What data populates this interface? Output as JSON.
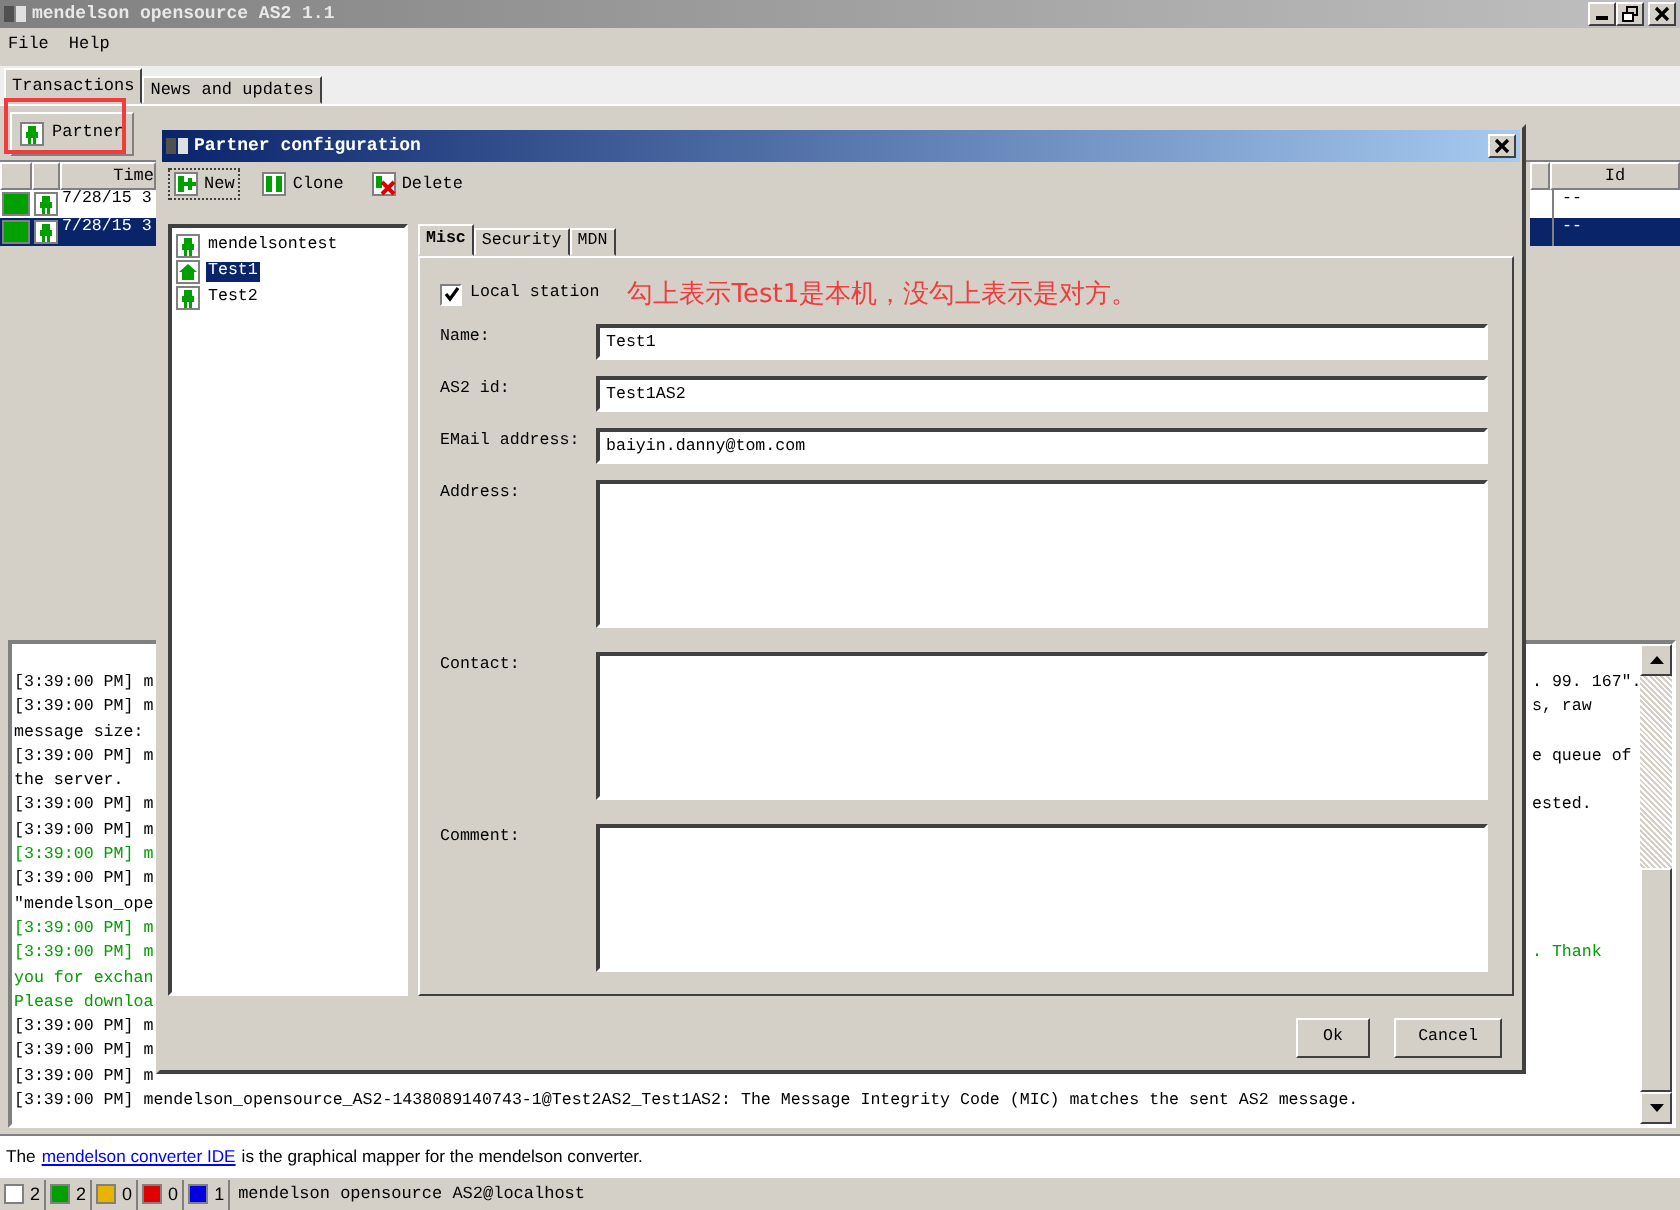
{
  "window": {
    "title": "mendelson opensource AS2 1.1"
  },
  "menu": [
    "File",
    "Help"
  ],
  "tabs": [
    {
      "label": "Transactions",
      "selected": true
    },
    {
      "label": "News and updates",
      "selected": false
    }
  ],
  "toolbar": {
    "partner_button": "Partner",
    "highlighted": true
  },
  "table": {
    "columns": [
      "Time",
      "Id"
    ],
    "rows": [
      {
        "color": "#00a000",
        "time": "7/28/15 3",
        "id": "--",
        "selected": false
      },
      {
        "color": "#00a000",
        "time": "7/28/15 3",
        "id": "--",
        "selected": true
      }
    ]
  },
  "log": [
    {
      "left": "[3:39:00 PM] m",
      "right": ". 99. 167\".",
      "kind": "normal"
    },
    {
      "left": "[3:39:00 PM] m",
      "right": "s, raw",
      "kind": "normal"
    },
    {
      "left": "message size:",
      "kind": "normal"
    },
    {
      "left": "[3:39:00 PM] m",
      "right": "e queue of",
      "kind": "normal"
    },
    {
      "left": "the server.",
      "kind": "normal"
    },
    {
      "left": "[3:39:00 PM] m",
      "right": "ested.",
      "kind": "normal"
    },
    {
      "left": "[3:39:00 PM] m",
      "kind": "normal"
    },
    {
      "left": "[3:39:00 PM] m",
      "kind": "success"
    },
    {
      "left": "[3:39:00 PM] m",
      "kind": "normal"
    },
    {
      "left": "\"mendelson_ope",
      "kind": "normal"
    },
    {
      "left": "[3:39:00 PM] m",
      "kind": "success"
    },
    {
      "left": "[3:39:00 PM] m",
      "right": ". Thank",
      "kind": "success"
    },
    {
      "left": "you for exchan",
      "kind": "success"
    },
    {
      "left": "Please downloa",
      "kind": "success"
    },
    {
      "left": "[3:39:00 PM] m",
      "kind": "normal"
    },
    {
      "left": "[3:39:00 PM] m",
      "kind": "normal"
    },
    {
      "left": "[3:39:00 PM] m",
      "kind": "normal"
    },
    {
      "left": "[3:39:00 PM] mendelson_opensource_AS2-1438089140743-1@Test2AS2_Test1AS2: The Message Integrity Code (MIC) matches the sent AS2 message.",
      "kind": "normal"
    }
  ],
  "info": {
    "before": "The",
    "link": "mendelson converter IDE",
    "after": "is the graphical mapper for the mendelson converter."
  },
  "status_bar": {
    "counters": [
      {
        "color": "#ffffff",
        "count": "2"
      },
      {
        "color": "#00a000",
        "count": "2"
      },
      {
        "color": "#e8b400",
        "count": "0"
      },
      {
        "color": "#e00000",
        "count": "0"
      },
      {
        "color": "#0000e0",
        "count": "1"
      }
    ],
    "text": "mendelson opensource AS2@localhost"
  },
  "dialog": {
    "title": "Partner configuration",
    "toolbar": [
      {
        "label": "New",
        "kind": "new"
      },
      {
        "label": "Clone",
        "kind": "clone"
      },
      {
        "label": "Delete",
        "kind": "delete"
      }
    ],
    "partners": [
      {
        "name": "mendelsontest",
        "kind": "remote",
        "selected": false
      },
      {
        "name": "Test1",
        "kind": "local",
        "selected": true
      },
      {
        "name": "Test2",
        "kind": "remote",
        "selected": false
      }
    ],
    "tabs": [
      {
        "label": "Misc",
        "selected": true
      },
      {
        "label": "Security",
        "selected": false
      },
      {
        "label": "MDN",
        "selected": false
      }
    ],
    "local_station": {
      "label": "Local station",
      "checked": true
    },
    "annotation": "勾上表示Test1是本机，没勾上表示是对方。",
    "fields": [
      {
        "label": "Name:",
        "value": "Test1",
        "kind": "line"
      },
      {
        "label": "AS2 id:",
        "value": "Test1AS2",
        "kind": "line"
      },
      {
        "label": "EMail address:",
        "value": "baiyin.danny@tom.com",
        "kind": "line"
      },
      {
        "label": "Address:",
        "kind": "area"
      },
      {
        "label": "Contact:",
        "kind": "area"
      },
      {
        "label": "Comment:",
        "kind": "area"
      }
    ],
    "buttons": [
      "Ok",
      "Cancel"
    ]
  }
}
